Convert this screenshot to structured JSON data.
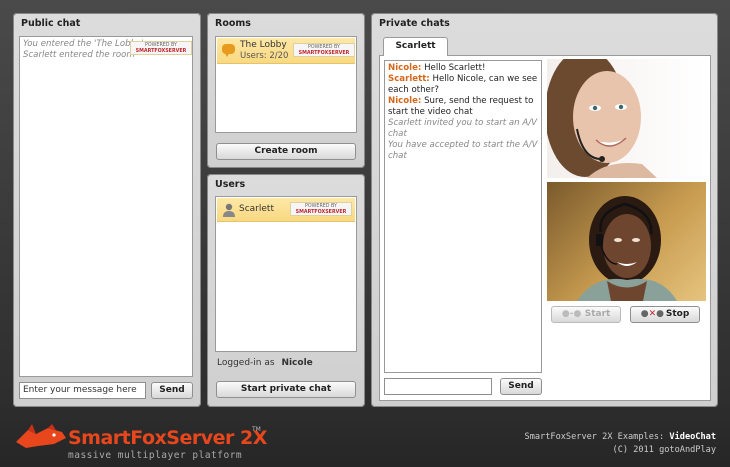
{
  "public_chat": {
    "title": "Public chat",
    "messages": [
      "You entered the 'The Lobby'",
      "Scarlett entered the room"
    ],
    "input_placeholder": "Enter your message here",
    "send_label": "Send"
  },
  "rooms": {
    "title": "Rooms",
    "items": [
      {
        "name": "The Lobby",
        "users": "Users: 2/20"
      }
    ],
    "create_label": "Create room"
  },
  "users": {
    "title": "Users",
    "items": [
      {
        "name": "Scarlett"
      }
    ],
    "logged_prefix": "Logged-in as",
    "logged_user": "Nicole",
    "start_private_label": "Start private chat"
  },
  "powered": {
    "line1": "POWERED BY",
    "line2": "SMARTFOXSERVER"
  },
  "private_chats": {
    "title": "Private chats",
    "tab": "Scarlett",
    "messages": [
      {
        "sender": "Nicole:",
        "text": " Hello Scarlett!"
      },
      {
        "sender": "Scarlett:",
        "text": " Hello Nicole, can we see each other?"
      },
      {
        "sender": "Nicole:",
        "text": " Sure, send the request to start the video chat"
      }
    ],
    "system": [
      "Scarlett invited you to start an A/V chat",
      "You have accepted to start the A/V chat"
    ],
    "send_label": "Send",
    "start_label": "Start",
    "stop_label": "Stop"
  },
  "footer": {
    "logo": "SmartFoxServer 2X",
    "tm": "TM",
    "tagline": "massive multiplayer platform",
    "examples_prefix": "SmartFoxServer 2X Examples:",
    "examples_name": "VideoChat",
    "copyright": "(C) 2011 gotoAndPlay"
  },
  "colors": {
    "accent_orange": "#d4681c",
    "selected_row": "#f9d981",
    "logo_red": "#e8461c"
  }
}
